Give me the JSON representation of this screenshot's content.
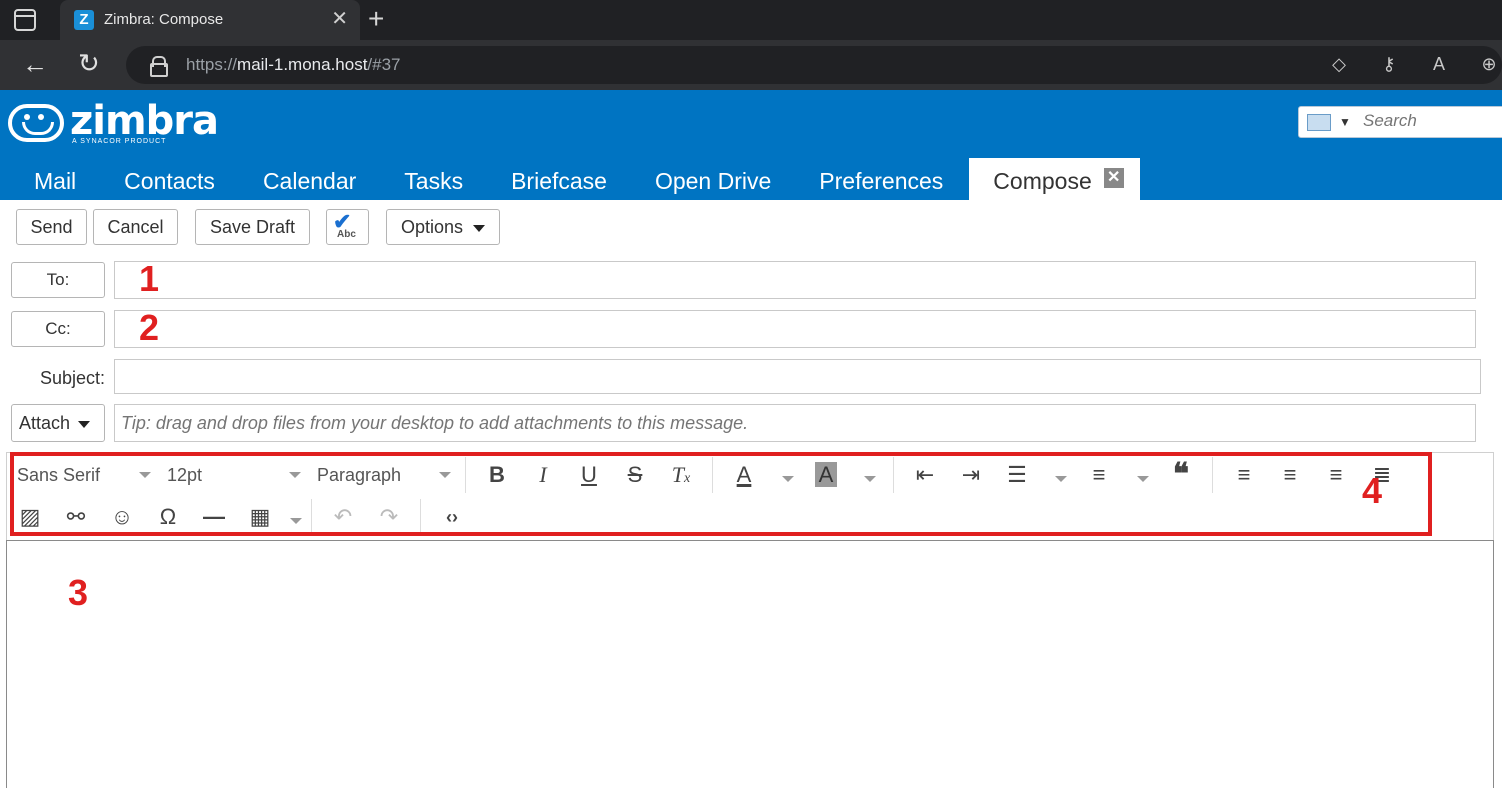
{
  "browser": {
    "tab_title": "Zimbra: Compose",
    "tab_favicon": "Z",
    "url_prefix": "https://",
    "url_host": "mail-1.mona.host",
    "url_path": "/#37"
  },
  "zimbra": {
    "logo_text": "zimbra",
    "logo_sub": "A SYNACOR PRODUCT",
    "search_placeholder": "Search",
    "tabs": [
      "Mail",
      "Contacts",
      "Calendar",
      "Tasks",
      "Briefcase",
      "Open Drive",
      "Preferences"
    ],
    "active_tab": "Compose"
  },
  "toolbar": {
    "send": "Send",
    "cancel": "Cancel",
    "save_draft": "Save Draft",
    "spell_abc": "Abc",
    "options": "Options"
  },
  "compose": {
    "to_label": "To:",
    "cc_label": "Cc:",
    "subject_label": "Subject:",
    "attach_label": "Attach",
    "attach_tip": "Tip: drag and drop files from your desktop to add attachments to this message."
  },
  "editor": {
    "font_family": "Sans Serif",
    "font_size": "12pt",
    "block_format": "Paragraph"
  },
  "annotations": {
    "m1": "1",
    "m2": "2",
    "m3": "3",
    "m4": "4",
    "color": "#e02020"
  }
}
